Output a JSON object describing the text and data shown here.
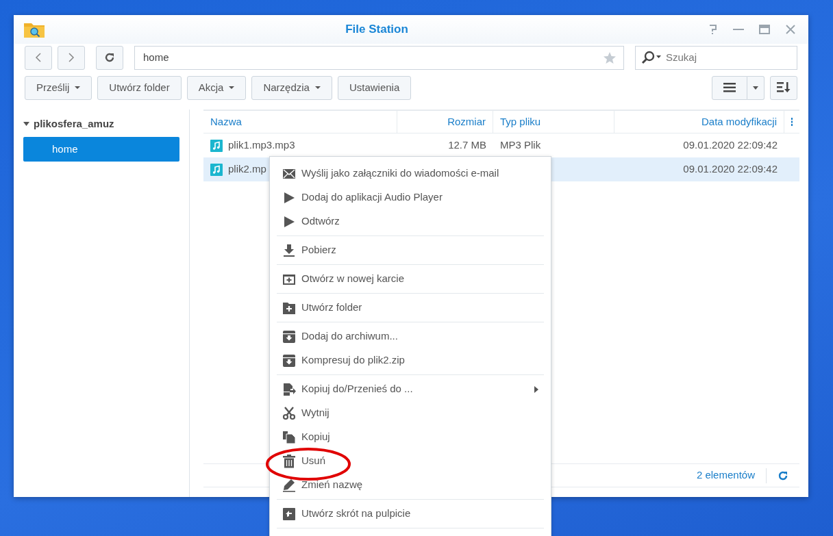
{
  "window": {
    "title": "File Station"
  },
  "address": {
    "value": "home",
    "starred": false
  },
  "search": {
    "placeholder": "Szukaj"
  },
  "toolbar": [
    {
      "label": "Prześlij",
      "dropdown": true
    },
    {
      "label": "Utwórz folder",
      "dropdown": false
    },
    {
      "label": "Akcja",
      "dropdown": true
    },
    {
      "label": "Narzędzia",
      "dropdown": true
    },
    {
      "label": "Ustawienia",
      "dropdown": false
    }
  ],
  "sidebar": {
    "items": [
      {
        "label": "plikosfera_amuz",
        "expanded": true,
        "selected": false,
        "children": [
          {
            "label": "home",
            "selected": true
          }
        ]
      }
    ]
  },
  "table": {
    "columns": [
      "Nazwa",
      "Rozmiar",
      "Typ pliku",
      "Data modyfikacji"
    ],
    "rows": [
      {
        "name": "plik1.mp3.mp3",
        "size": "12.7 MB",
        "type": "MP3 Plik",
        "modified": "09.01.2020 22:09:42",
        "selected": false
      },
      {
        "name": "plik2.mp",
        "modified": "09.01.2020 22:09:42",
        "selected": true
      }
    ]
  },
  "status_bar": {
    "count": "2 elementów"
  },
  "context_menu": {
    "groups": [
      [
        {
          "label": "Wyślij jako załączniki do wiadomości e-mail",
          "kind": "mail",
          "submenu": false
        },
        {
          "label": "Dodaj do aplikacji Audio Player",
          "kind": "play",
          "submenu": false
        },
        {
          "label": "Odtwórz",
          "kind": "play",
          "submenu": false
        }
      ],
      [
        {
          "label": "Pobierz",
          "kind": "download",
          "submenu": false
        }
      ],
      [
        {
          "label": "Otwórz w nowej karcie",
          "kind": "newtab",
          "submenu": false
        }
      ],
      [
        {
          "label": "Utwórz folder",
          "kind": "folderplus",
          "submenu": false
        }
      ],
      [
        {
          "label": "Dodaj do archiwum...",
          "kind": "archive",
          "submenu": false
        },
        {
          "label": "Kompresuj do plik2.zip",
          "kind": "archive",
          "submenu": false
        }
      ],
      [
        {
          "label": "Kopiuj do/Przenieś do ...",
          "kind": "copyto",
          "submenu": true
        },
        {
          "label": "Wytnij",
          "kind": "scissors",
          "submenu": false
        },
        {
          "label": "Kopiuj",
          "kind": "copy",
          "submenu": false
        },
        {
          "label": "Usuń",
          "kind": "trash",
          "submenu": false
        },
        {
          "label": "Zmień nazwę",
          "kind": "pencil",
          "submenu": false
        }
      ],
      [
        {
          "label": "Utwórz skrót na pulpicie",
          "kind": "shortcut",
          "submenu": false
        }
      ]
    ]
  }
}
